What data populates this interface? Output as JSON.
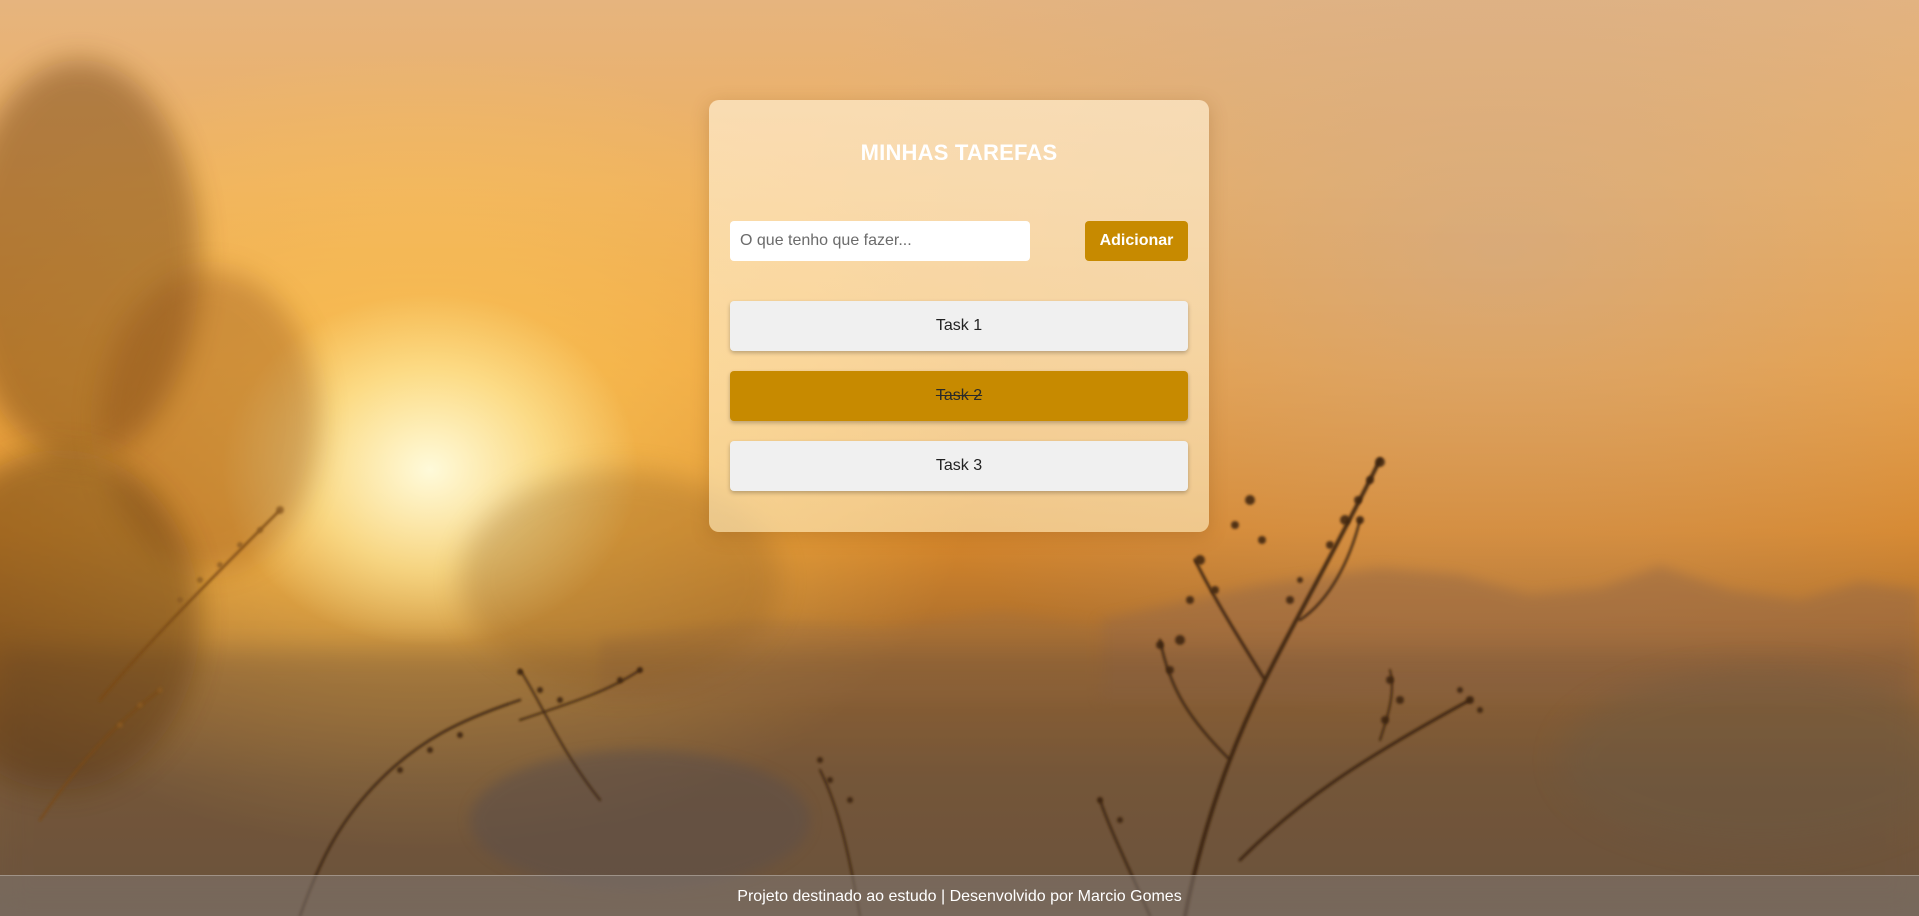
{
  "app": {
    "title": "MINHAS TAREFAS"
  },
  "form": {
    "input_value": "",
    "input_placeholder": "O que tenho que fazer...",
    "add_label": "Adicionar"
  },
  "tasks": [
    {
      "label": "Task 1",
      "done": false
    },
    {
      "label": "Task 2",
      "done": true
    },
    {
      "label": "Task 3",
      "done": false
    }
  ],
  "footer": {
    "text": "Projeto destinado ao estudo | Desenvolvido por Marcio Gomes"
  },
  "colors": {
    "accent": "#c78a00",
    "task_background": "#f0f0f0",
    "title_text": "#ffffff"
  },
  "background": {
    "description": "blurred desert sunset photo with silhouetted plants"
  }
}
